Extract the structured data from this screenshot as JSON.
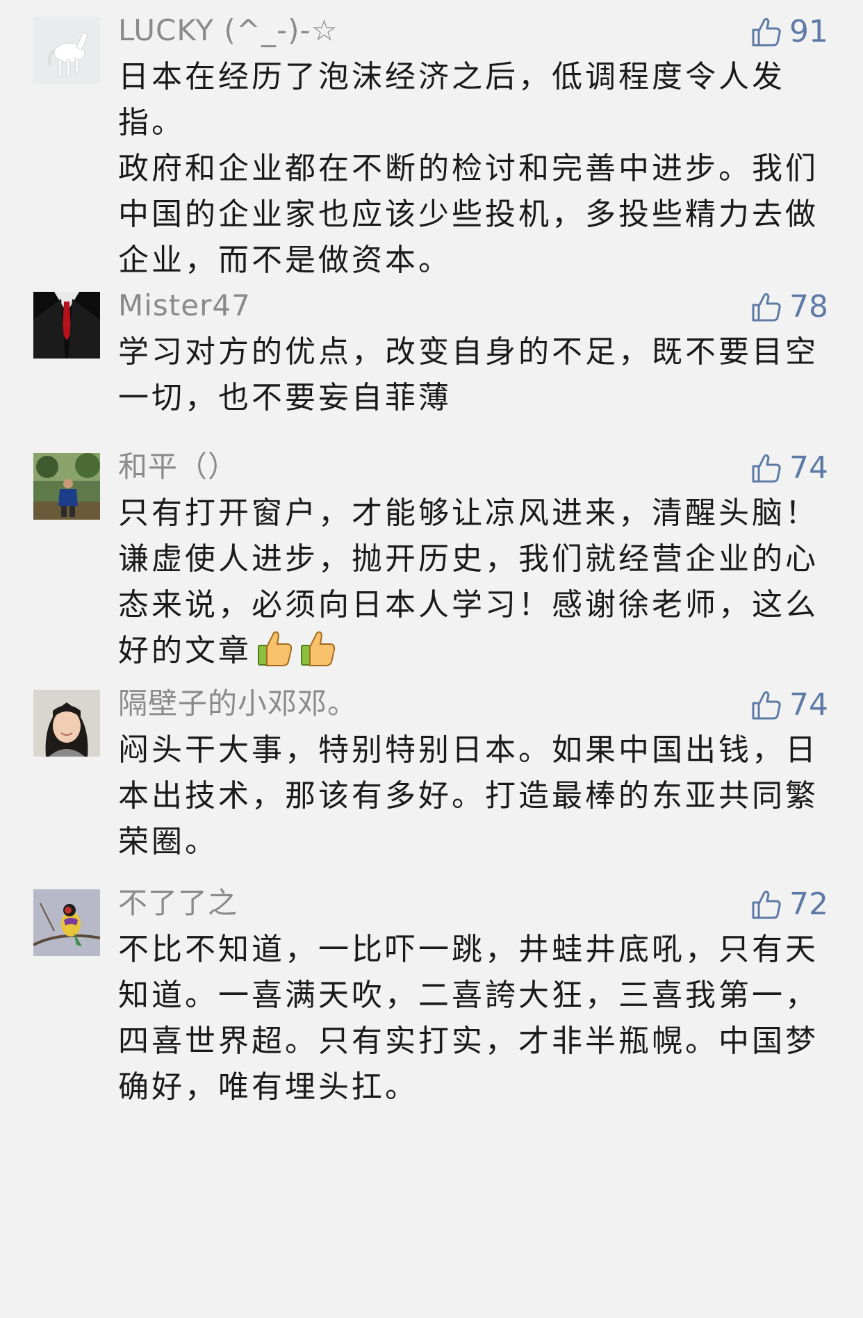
{
  "comments": [
    {
      "username": "LUCKY (^_-)-☆",
      "likes": "91",
      "avatar_icon": "white-horse-avatar",
      "paragraphs": [
        "日本在经历了泡沫经济之后，低调程度令人发指。",
        "政府和企业都在不断的检讨和完善中进步。我们中国的企业家也应该少些投机，多投些精力去做企业，而不是做资本。"
      ]
    },
    {
      "username": "Mister47",
      "likes": "78",
      "avatar_icon": "suit-red-tie-avatar",
      "paragraphs": [
        "学习对方的优点，改变自身的不足，既不要目空一切，也不要妄自菲薄"
      ]
    },
    {
      "username": "和平（）",
      "likes": "74",
      "avatar_icon": "man-in-park-avatar",
      "paragraphs": [
        "只有打开窗户，才能够让凉风进来，清醒头脑！谦虚使人进步，抛开历史，我们就经营企业的心态来说，必须向日本人学习！感谢徐老师，这么好的文章"
      ],
      "emoji": [
        "thumbs-up-emoji",
        "thumbs-up-emoji"
      ]
    },
    {
      "username": "隔壁子的小邓邓。",
      "likes": "74",
      "avatar_icon": "woman-portrait-avatar",
      "paragraphs": [
        "闷头干大事，特别特别日本。如果中国出钱，日本出技术，那该有多好。打造最棒的东亚共同繁荣圈。"
      ]
    },
    {
      "username": "不了了之",
      "likes": "72",
      "avatar_icon": "bird-on-branch-avatar",
      "paragraphs": [
        "不比不知道，一比吓一跳，井蛙井底吼，只有天知道。一喜满天吹，二喜誇大狂，三喜我第一，四喜世界超。只有实打实，才非半瓶幌。中国梦确好，唯有埋头扛。"
      ]
    }
  ],
  "colors": {
    "background": "#f2f2f2",
    "username": "#8a8a8a",
    "like_accent": "#5d7aa6",
    "text": "#1a1a1a"
  }
}
